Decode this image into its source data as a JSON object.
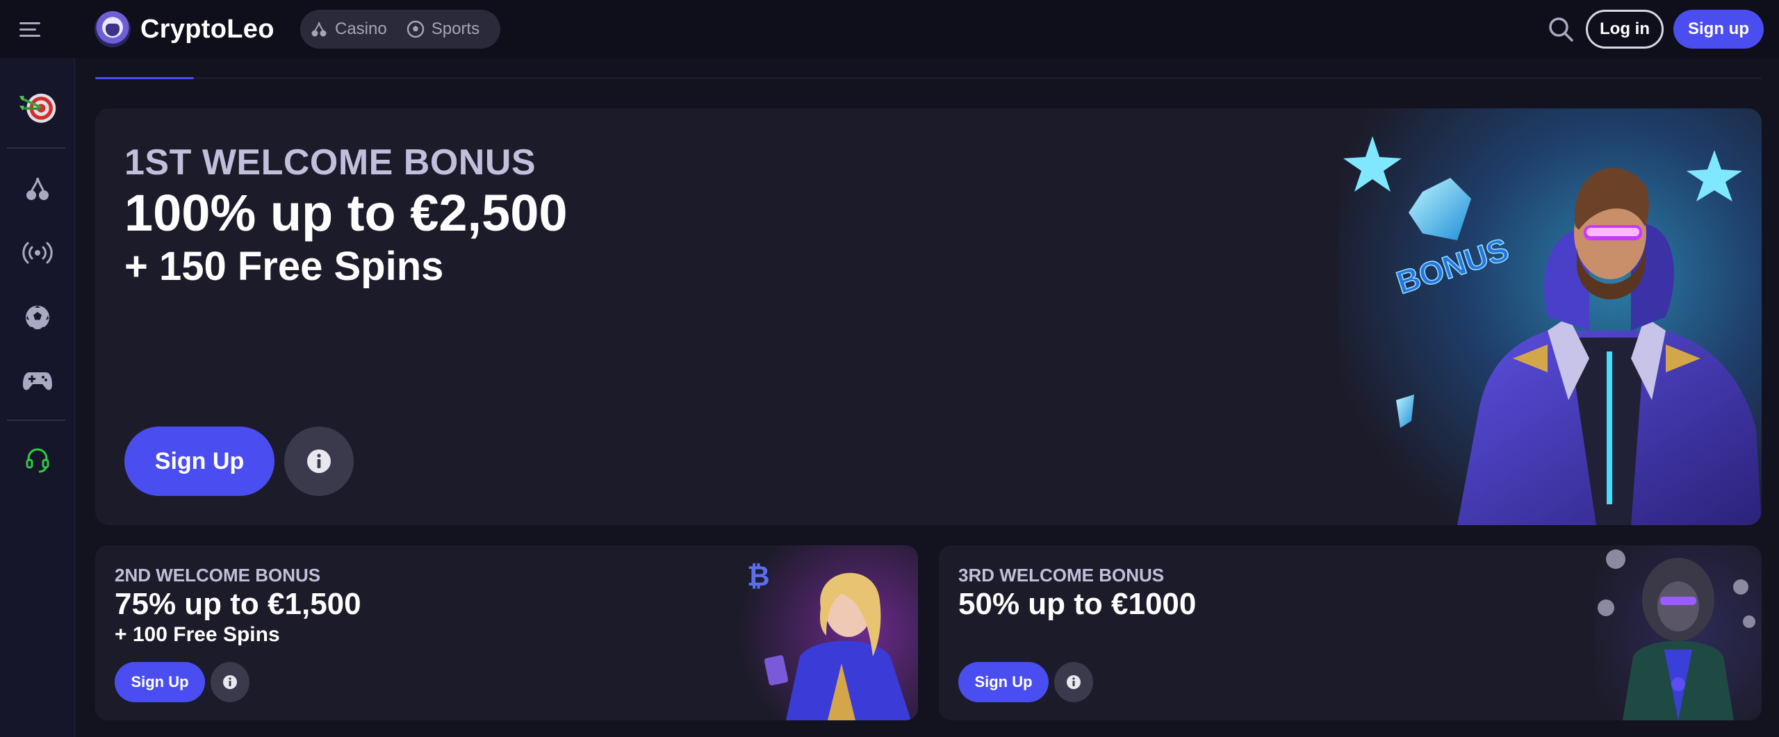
{
  "header": {
    "brand_name": "CryptoLeo",
    "nav": [
      {
        "label": "Casino",
        "icon": "cherries-icon"
      },
      {
        "label": "Sports",
        "icon": "soccer-ball-icon"
      }
    ],
    "login_label": "Log in",
    "signup_label": "Sign up"
  },
  "sidebar": {
    "items": [
      {
        "icon": "dart-target-icon"
      },
      {
        "icon": "cherries-icon"
      },
      {
        "icon": "live-broadcast-icon"
      },
      {
        "icon": "soccer-ball-icon"
      },
      {
        "icon": "gamepad-icon"
      },
      {
        "icon": "headset-support-icon"
      }
    ]
  },
  "hero": {
    "kicker": "1ST WELCOME BONUS",
    "title": "100% up to €2,500",
    "subtitle": "+ 150 Free Spins",
    "signup_label": "Sign Up",
    "art_badge": "BONUS"
  },
  "cards": [
    {
      "kicker": "2ND WELCOME BONUS",
      "title": "75% up to €1,500",
      "subtitle": "+ 100 Free Spins",
      "signup_label": "Sign Up"
    },
    {
      "kicker": "3RD WELCOME BONUS",
      "title": "50% up to €1000",
      "subtitle": "",
      "signup_label": "Sign Up"
    }
  ],
  "colors": {
    "accent": "#4a4ef0",
    "background": "#131320",
    "surface": "#1c1b29",
    "support_green": "#2ecc40"
  }
}
